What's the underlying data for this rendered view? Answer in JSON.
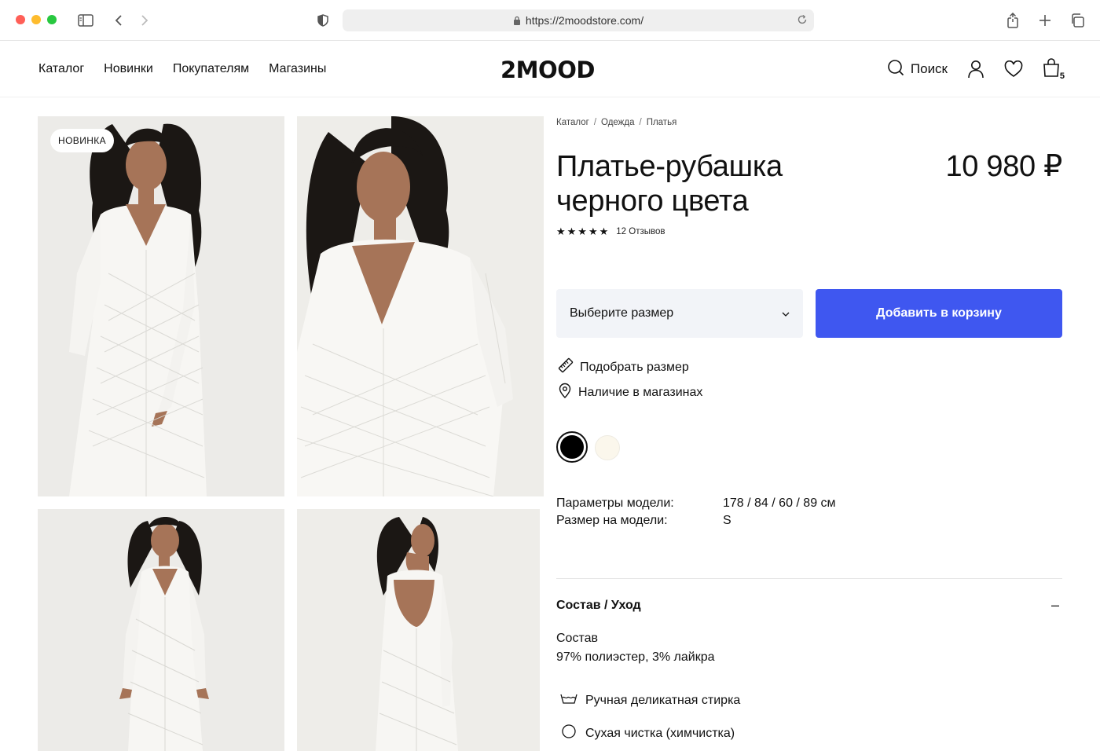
{
  "browser": {
    "url": "https://2moodstore.com/"
  },
  "header": {
    "nav": [
      "Каталог",
      "Новинки",
      "Покупателям",
      "Магазины"
    ],
    "logo": "2MOOD",
    "search_label": "Поиск",
    "cart_count": "5"
  },
  "gallery": {
    "badge": "НОВИНКА"
  },
  "product": {
    "breadcrumb": [
      "Каталог",
      "Одежда",
      "Платья"
    ],
    "title_line1": "Платье-рубашка",
    "title_line2": "черного цвета",
    "price": "10 980 ₽",
    "stars": "★★★★★",
    "reviews": "12 Отзывов",
    "size_placeholder": "Выберите размер",
    "add_to_cart": "Добавить в корзину",
    "size_guide": "Подобрать размер",
    "store_availability": "Наличие в магазинах",
    "colors": [
      "#000000",
      "#fbf7ec"
    ],
    "model_params_label": "Параметры модели:",
    "model_params_value": "178 / 84 / 60 / 89 см",
    "model_size_label": "Размер на модели:",
    "model_size_value": "S"
  },
  "composition": {
    "header": "Состав / Уход",
    "toggle": "–",
    "label": "Состав",
    "value": "97% полиэстер, 3% лайкра",
    "care": [
      "Ручная деликатная стирка",
      "Сухая чистка (химчистка)"
    ]
  },
  "colors": {
    "accent": "#3f57f0",
    "select_bg": "#f2f4f8"
  }
}
